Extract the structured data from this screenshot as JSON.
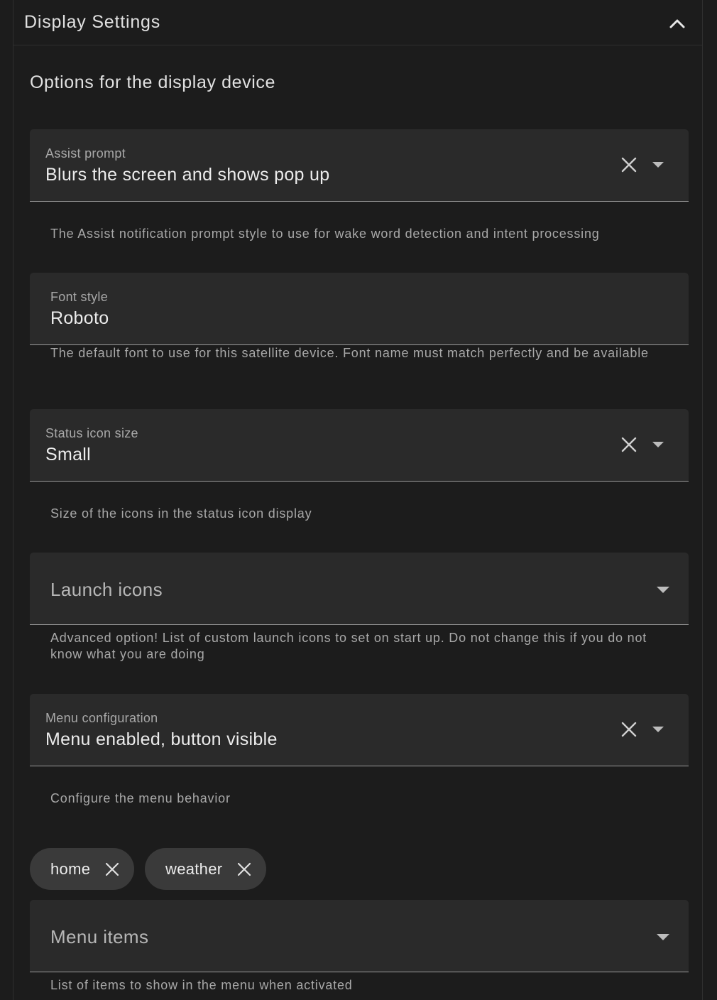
{
  "header": {
    "title": "Display Settings"
  },
  "section": {
    "description": "Options for the display device"
  },
  "fields": {
    "assist_prompt": {
      "label": "Assist prompt",
      "value": "Blurs the screen and shows pop up",
      "helper": "The Assist notification prompt style to use for wake word detection and intent processing"
    },
    "font_style": {
      "label": "Font style",
      "value": "Roboto",
      "helper": "The default font to use for this satellite device. Font name must match perfectly and be available"
    },
    "status_icon_size": {
      "label": "Status icon size",
      "value": "Small",
      "helper": "Size of the icons in the status icon display"
    },
    "launch_icons": {
      "placeholder": "Launch icons",
      "helper": "Advanced option! List of custom launch icons to set on start up. Do not change this if you do not know what you are doing"
    },
    "menu_configuration": {
      "label": "Menu configuration",
      "value": "Menu enabled, button visible",
      "helper": "Configure the menu behavior"
    },
    "menu_items": {
      "chips": [
        "home",
        "weather"
      ],
      "placeholder": "Menu items",
      "helper": "List of items to show in the menu when activated"
    }
  },
  "icons": {
    "collapse": "chevron-up-icon",
    "clear": "close-icon",
    "dropdown": "caret-down-icon"
  },
  "colors": {
    "background": "#1c1c1c",
    "field_background": "#2a2a2a",
    "chip_background": "#3a3a3a",
    "text_primary": "#e1e1e1",
    "text_secondary": "#a8a8a8"
  }
}
